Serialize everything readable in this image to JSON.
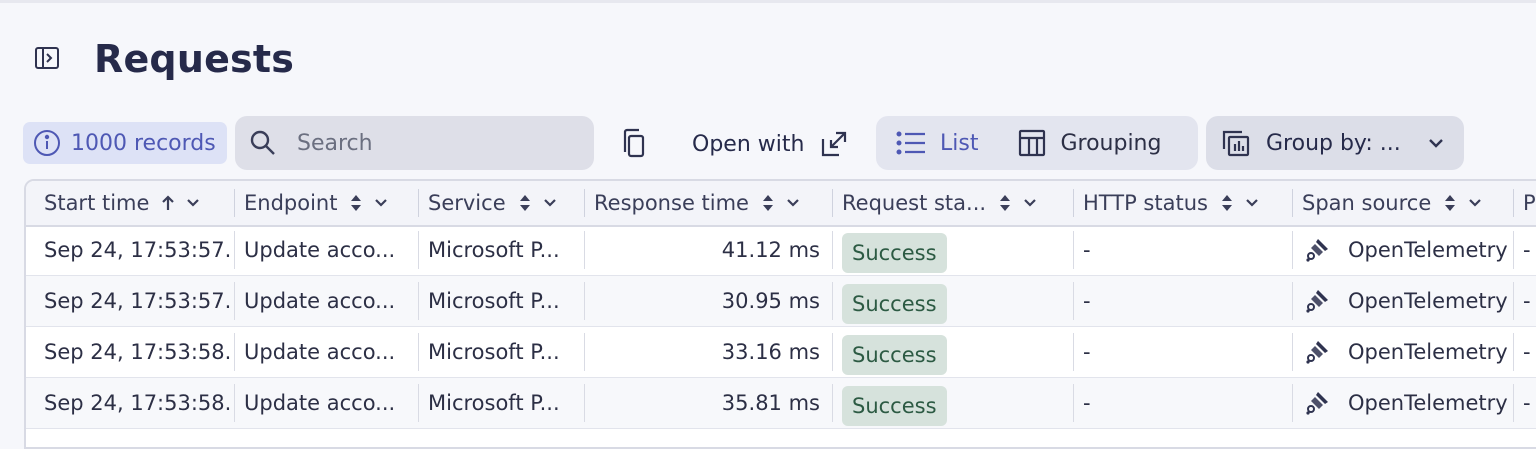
{
  "page": {
    "title": "Requests"
  },
  "toolbar": {
    "records": "1000 records",
    "search_placeholder": "Search",
    "open_with": "Open with",
    "view_list": "List",
    "view_grouping": "Grouping",
    "group_by": "Group by: ..."
  },
  "table": {
    "columns": [
      "Start time",
      "Endpoint",
      "Service",
      "Response time",
      "Request sta...",
      "HTTP status",
      "Span source",
      "P"
    ],
    "rows": [
      {
        "start": "Sep 24, 17:53:57.",
        "endpoint": "Update acco...",
        "service": "Microsoft P...",
        "response": "41.12 ms",
        "request_status": "Success",
        "http_status": "-",
        "span_source": "OpenTelemetry",
        "extra": "-"
      },
      {
        "start": "Sep 24, 17:53:57.",
        "endpoint": "Update acco...",
        "service": "Microsoft P...",
        "response": "30.95 ms",
        "request_status": "Success",
        "http_status": "-",
        "span_source": "OpenTelemetry",
        "extra": "-"
      },
      {
        "start": "Sep 24, 17:53:58.",
        "endpoint": "Update acco...",
        "service": "Microsoft P...",
        "response": "33.16 ms",
        "request_status": "Success",
        "http_status": "-",
        "span_source": "OpenTelemetry",
        "extra": "-"
      },
      {
        "start": "Sep 24, 17:53:58.",
        "endpoint": "Update acco...",
        "service": "Microsoft P...",
        "response": "35.81 ms",
        "request_status": "Success",
        "http_status": "-",
        "span_source": "OpenTelemetry",
        "extra": "-"
      }
    ]
  },
  "colors": {
    "accent": "#4e58b4",
    "success_bg": "#d6e2dc",
    "success_text": "#2c5a43"
  }
}
